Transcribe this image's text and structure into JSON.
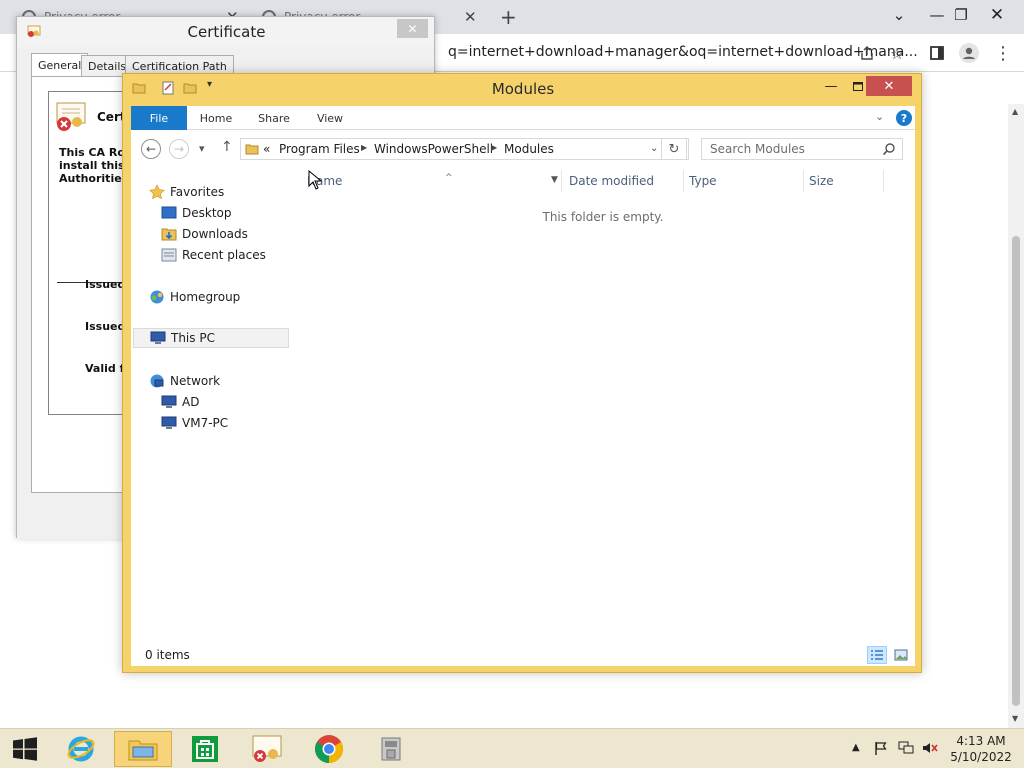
{
  "browser": {
    "tabs": [
      {
        "label": "Privacy error"
      },
      {
        "label": "Privacy error"
      }
    ],
    "new_tab": "+",
    "omnibox_url": "q=internet+download+manager&oq=internet+download+mana..."
  },
  "certificate_dialog": {
    "title": "Certificate",
    "close": "✕",
    "tabs": [
      {
        "label": "General"
      },
      {
        "label": "Details"
      },
      {
        "label": "Certification Path"
      }
    ],
    "heading": "Cert",
    "body_lines": [
      "This CA Roo",
      "install this c",
      "Authorities"
    ],
    "fields": [
      "Issued",
      "Issued",
      "Valid f"
    ]
  },
  "explorer": {
    "title": "Modules",
    "ribbon": {
      "file": "File",
      "tabs": [
        "Home",
        "Share",
        "View"
      ],
      "help": "?"
    },
    "address": {
      "overflow": "«",
      "segments": [
        "Program Files",
        "WindowsPowerShell",
        "Modules"
      ]
    },
    "search": {
      "placeholder": "Search Modules"
    },
    "nav_pane": {
      "favorites": "Favorites",
      "favorite_items": [
        "Desktop",
        "Downloads",
        "Recent places"
      ],
      "homegroup": "Homegroup",
      "this_pc": "This PC",
      "network": "Network",
      "network_items": [
        "AD",
        "VM7-PC"
      ]
    },
    "columns": [
      "Name",
      "Date modified",
      "Type",
      "Size"
    ],
    "empty_message": "This folder is empty.",
    "status": "0 items"
  },
  "taskbar": {
    "clock_time": "4:13 AM",
    "clock_date": "5/10/2022"
  },
  "colors": {
    "explorer_frame": "#f6d26a",
    "ribbon_file": "#1979ca",
    "close_button": "#c75050",
    "taskbar": "#ede7d0"
  }
}
